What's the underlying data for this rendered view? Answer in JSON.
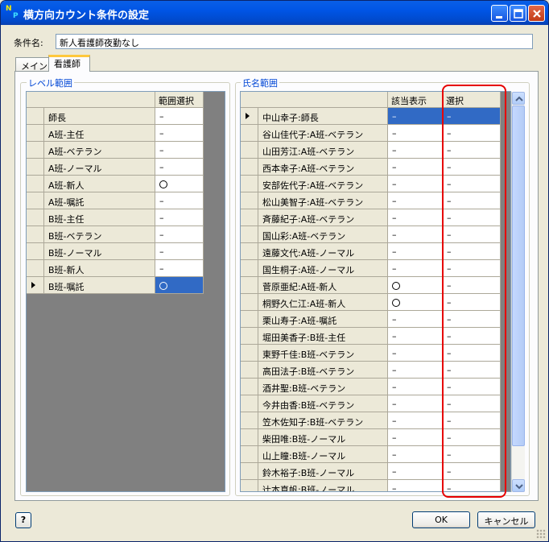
{
  "window": {
    "title": "横方向カウント条件の設定",
    "app_icon": "np-icon"
  },
  "condition": {
    "label": "条件名:",
    "value": "新人看護師夜勤なし"
  },
  "tabs": [
    {
      "label": "メイン"
    },
    {
      "label": "看護師"
    }
  ],
  "level_group": {
    "title": "レベル範囲",
    "header": "範囲選択",
    "rows": [
      {
        "label": "師長",
        "value": "–"
      },
      {
        "label": "A班-主任",
        "value": "–"
      },
      {
        "label": "A班-ベテラン",
        "value": "–"
      },
      {
        "label": "A班-ノーマル",
        "value": "–"
      },
      {
        "label": "A班-新人",
        "value": "○"
      },
      {
        "label": "A班-嘱託",
        "value": "–"
      },
      {
        "label": "B班-主任",
        "value": "–"
      },
      {
        "label": "B班-ベテラン",
        "value": "–"
      },
      {
        "label": "B班-ノーマル",
        "value": "–"
      },
      {
        "label": "B班-新人",
        "value": "–"
      },
      {
        "label": "B班-嘱託",
        "value": "○"
      }
    ]
  },
  "name_group": {
    "title": "氏名範囲",
    "headers": {
      "applicable": "該当表示",
      "selection": "選択"
    },
    "rows": [
      {
        "name": "中山幸子:師長",
        "applicable": "–",
        "selection": "–"
      },
      {
        "name": "谷山佳代子:A班-ベテラン",
        "applicable": "–",
        "selection": "–"
      },
      {
        "name": "山田芳江:A班-ベテラン",
        "applicable": "–",
        "selection": "–"
      },
      {
        "name": "西本幸子:A班-ベテラン",
        "applicable": "–",
        "selection": "–"
      },
      {
        "name": "安部佐代子:A班-ベテラン",
        "applicable": "–",
        "selection": "–"
      },
      {
        "name": "松山美智子:A班-ベテラン",
        "applicable": "–",
        "selection": "–"
      },
      {
        "name": "斉藤紀子:A班-ベテラン",
        "applicable": "–",
        "selection": "–"
      },
      {
        "name": "国山彩:A班-ベテラン",
        "applicable": "–",
        "selection": "–"
      },
      {
        "name": "遠藤文代:A班-ノーマル",
        "applicable": "–",
        "selection": "–"
      },
      {
        "name": "国生桐子:A班-ノーマル",
        "applicable": "–",
        "selection": "–"
      },
      {
        "name": "菅原亜紀:A班-新人",
        "applicable": "○",
        "selection": "–"
      },
      {
        "name": "桐野久仁江:A班-新人",
        "applicable": "○",
        "selection": "–"
      },
      {
        "name": "栗山寿子:A班-嘱託",
        "applicable": "–",
        "selection": "–"
      },
      {
        "name": "堀田美香子:B班-主任",
        "applicable": "–",
        "selection": "–"
      },
      {
        "name": "東野千佳:B班-ベテラン",
        "applicable": "–",
        "selection": "–"
      },
      {
        "name": "高田法子:B班-ベテラン",
        "applicable": "–",
        "selection": "–"
      },
      {
        "name": "酒井聖:B班-ベテラン",
        "applicable": "–",
        "selection": "–"
      },
      {
        "name": "今井由香:B班-ベテラン",
        "applicable": "–",
        "selection": "–"
      },
      {
        "name": "笠木佐知子:B班-ベテラン",
        "applicable": "–",
        "selection": "–"
      },
      {
        "name": "柴田唯:B班-ノーマル",
        "applicable": "–",
        "selection": "–"
      },
      {
        "name": "山上瞳:B班-ノーマル",
        "applicable": "–",
        "selection": "–"
      },
      {
        "name": "鈴木裕子:B班-ノーマル",
        "applicable": "–",
        "selection": "–"
      },
      {
        "name": "辻本真帆:B班-ノーマル",
        "applicable": "–",
        "selection": "–"
      }
    ]
  },
  "footer": {
    "help_label": "?",
    "ok_label": "OK",
    "cancel_label": "キャンセル"
  },
  "colors": {
    "selection": "#316ac5",
    "highlight_outline": "#e60000",
    "title_bar": "#0055e5"
  }
}
